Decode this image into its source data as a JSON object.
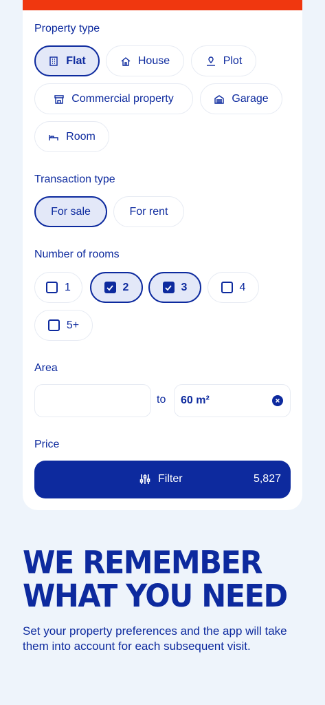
{
  "property_type": {
    "title": "Property type",
    "options": [
      {
        "label": "Flat",
        "icon": "building-icon",
        "selected": true
      },
      {
        "label": "House",
        "icon": "house-icon",
        "selected": false
      },
      {
        "label": "Plot",
        "icon": "plot-icon",
        "selected": false
      },
      {
        "label": "Commercial property",
        "icon": "store-icon",
        "selected": false
      },
      {
        "label": "Garage",
        "icon": "garage-icon",
        "selected": false
      },
      {
        "label": "Room",
        "icon": "bed-icon",
        "selected": false
      }
    ]
  },
  "transaction_type": {
    "title": "Transaction type",
    "options": [
      {
        "label": "For sale",
        "selected": true
      },
      {
        "label": "For rent",
        "selected": false
      }
    ]
  },
  "rooms": {
    "title": "Number of rooms",
    "options": [
      {
        "label": "1",
        "checked": false
      },
      {
        "label": "2",
        "checked": true
      },
      {
        "label": "3",
        "checked": true
      },
      {
        "label": "4",
        "checked": false
      },
      {
        "label": "5+",
        "checked": false
      }
    ]
  },
  "area": {
    "title": "Area",
    "from_value": "",
    "to_label": "to",
    "to_value": "60 m²"
  },
  "price": {
    "title": "Price"
  },
  "filter": {
    "label": "Filter",
    "count": "5,827"
  },
  "promo": {
    "headline_line1": "WE REMEMBER",
    "headline_line2": "WHAT YOU NEED",
    "body": "Set your property preferences and the app will take them into account for each subsequent visit."
  },
  "colors": {
    "primary": "#0d2a9e",
    "accent_bar": "#f0370f",
    "selected_bg": "#e3e8f8",
    "page_bg": "#eef4fb"
  }
}
